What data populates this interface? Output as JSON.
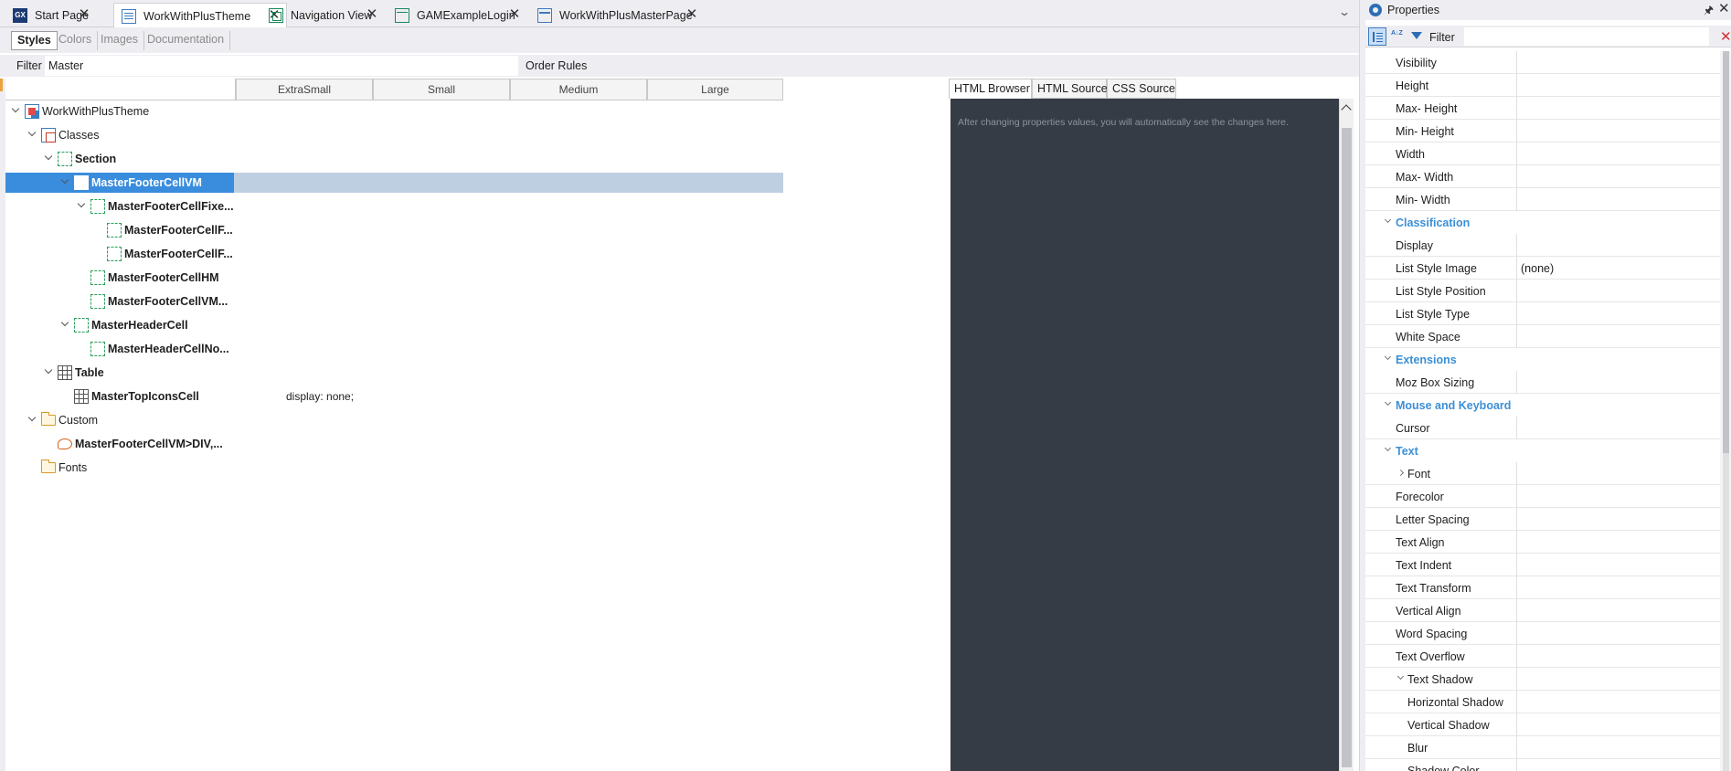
{
  "doc_tabs": [
    {
      "label": "Start Page",
      "icon": "gx-logo-icon"
    },
    {
      "label": "WorkWithPlusTheme",
      "icon": "theme-icon",
      "active": true
    },
    {
      "label": "Navigation View",
      "icon": "navigation-view-icon"
    },
    {
      "label": "GAMExampleLogin",
      "icon": "web-panel-icon"
    },
    {
      "label": "WorkWithPlusMasterPage",
      "icon": "master-page-icon"
    }
  ],
  "gx_logo_text": "GX",
  "close_glyph": "✕",
  "subtabs": [
    "Styles",
    "Colors",
    "Images",
    "Documentation"
  ],
  "filter": {
    "label": "Filter",
    "value": "Master"
  },
  "order_rules_label": "Order Rules",
  "columns": [
    "ExtraSmall",
    "Small",
    "Medium",
    "Large"
  ],
  "tree": [
    {
      "label": "WorkWithPlusTheme",
      "icon": "theme-icon",
      "bold": false
    },
    {
      "label": "Classes",
      "icon": "classes-icon",
      "bold": false
    },
    {
      "label": "Section",
      "icon": "class-icon",
      "bold": true
    },
    {
      "label": "MasterFooterCellVM",
      "icon": "class-icon",
      "bold": true,
      "selected": true
    },
    {
      "label": "MasterFooterCellFixe...",
      "icon": "class-icon",
      "bold": true
    },
    {
      "label": "MasterFooterCellF...",
      "icon": "class-icon",
      "bold": true
    },
    {
      "label": "MasterFooterCellF...",
      "icon": "class-icon",
      "bold": true
    },
    {
      "label": "MasterFooterCellHM",
      "icon": "class-icon",
      "bold": true
    },
    {
      "label": "MasterFooterCellVM...",
      "icon": "class-icon",
      "bold": true
    },
    {
      "label": "MasterHeaderCell",
      "icon": "class-icon",
      "bold": true
    },
    {
      "label": "MasterHeaderCellNo...",
      "icon": "class-icon",
      "bold": true
    },
    {
      "label": "Table",
      "icon": "table-icon",
      "bold": true
    },
    {
      "label": "MasterTopIconsCell",
      "icon": "table-icon",
      "bold": true,
      "value": "display: none;"
    },
    {
      "label": "Custom",
      "icon": "folder-icon",
      "bold": false
    },
    {
      "label": "MasterFooterCellVM>DIV,...",
      "icon": "custom-rule-icon",
      "bold": true
    },
    {
      "label": "Fonts",
      "icon": "folder-icon",
      "bold": false
    }
  ],
  "preview": {
    "tabs": [
      "HTML Browser",
      "HTML Source",
      "CSS Source"
    ],
    "hint": "After changing properties values, you will automatically see the changes here."
  },
  "properties": {
    "title": "Properties",
    "pin_glyph": "🖈",
    "close_glyph": "✕",
    "filter_label": "Filter",
    "filter_value": "",
    "clear_glyph": "✕",
    "alpha_glyph": "A↓Z",
    "rows": [
      {
        "name": "Visibility",
        "value": ""
      },
      {
        "name": "Height",
        "value": ""
      },
      {
        "name": "Max- Height",
        "value": ""
      },
      {
        "name": "Min- Height",
        "value": ""
      },
      {
        "name": "Width",
        "value": ""
      },
      {
        "name": "Max- Width",
        "value": ""
      },
      {
        "name": "Min- Width",
        "value": ""
      },
      {
        "category": "Classification"
      },
      {
        "name": "Display",
        "value": ""
      },
      {
        "name": "List Style Image",
        "value": "(none)"
      },
      {
        "name": "List Style Position",
        "value": ""
      },
      {
        "name": "List Style Type",
        "value": ""
      },
      {
        "name": "White Space",
        "value": ""
      },
      {
        "category": "Extensions"
      },
      {
        "name": "Moz Box Sizing",
        "value": ""
      },
      {
        "category": "Mouse and Keyboard"
      },
      {
        "name": "Cursor",
        "value": ""
      },
      {
        "category": "Text"
      },
      {
        "name": "Font",
        "value": "",
        "expandable": true
      },
      {
        "name": "Forecolor",
        "value": ""
      },
      {
        "name": "Letter Spacing",
        "value": ""
      },
      {
        "name": "Text Align",
        "value": ""
      },
      {
        "name": "Text Indent",
        "value": ""
      },
      {
        "name": "Text Transform",
        "value": ""
      },
      {
        "name": "Vertical Align",
        "value": ""
      },
      {
        "name": "Word Spacing",
        "value": ""
      },
      {
        "name": "Text Overflow",
        "value": ""
      },
      {
        "name": "Text Shadow",
        "value": "",
        "expanded": true
      },
      {
        "name": "Horizontal Shadow",
        "value": "",
        "sub": true
      },
      {
        "name": "Vertical Shadow",
        "value": "",
        "sub": true
      },
      {
        "name": "Blur",
        "value": "",
        "sub": true
      },
      {
        "name": "Shadow Color",
        "value": "",
        "sub": true
      }
    ]
  },
  "colors": {
    "selection": "#3a8ddd",
    "selection_band": "#bfcfe2",
    "preview_bg": "#363c45",
    "category_text": "#3b8fd6",
    "class_icon": "#2aa05a"
  }
}
